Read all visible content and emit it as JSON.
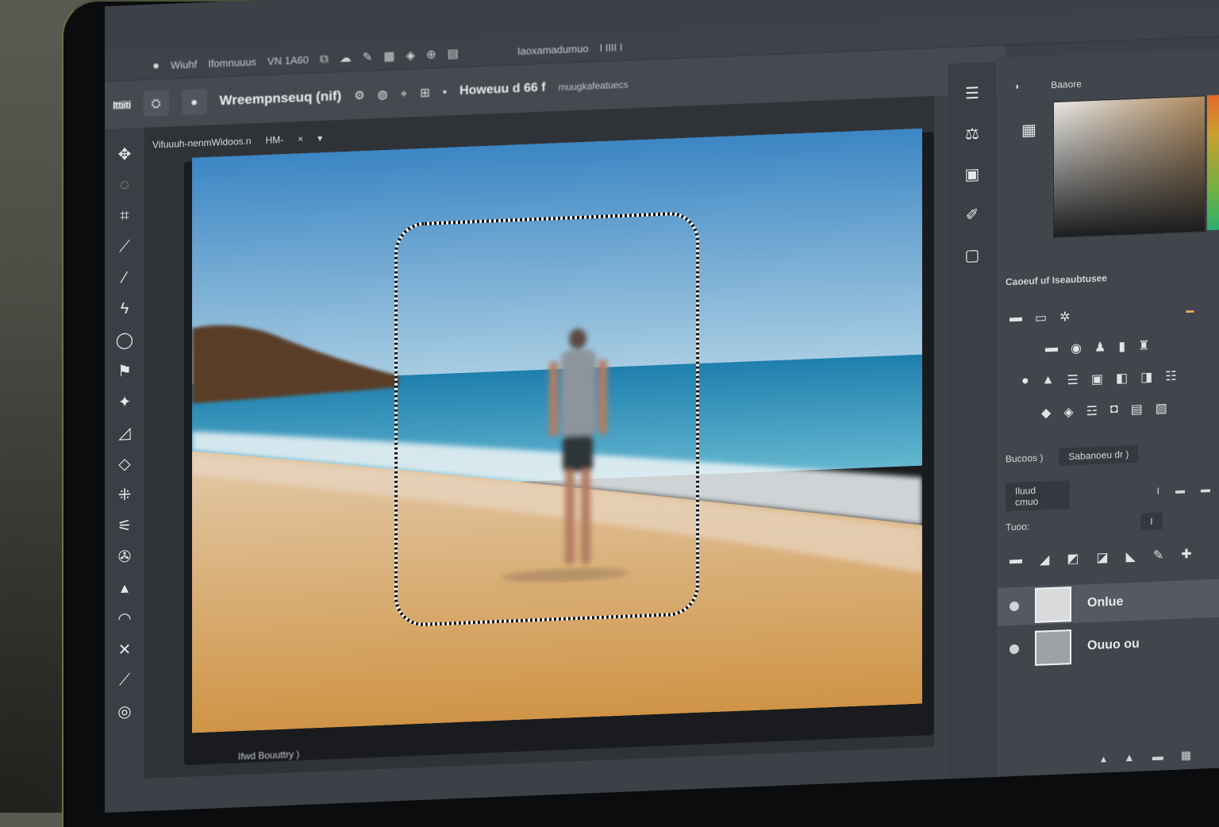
{
  "menubar": {
    "items": [
      "Wiuhf",
      "Ifomnuuus",
      "VN 1A60"
    ],
    "icons": [
      "bell-icon",
      "layers-icon",
      "cloud-icon",
      "pen-icon",
      "grid-icon",
      "shapes-icon",
      "zoom-icon",
      "window-icon"
    ],
    "right": [
      "Iaoxamadumuo",
      "I IIII I"
    ]
  },
  "options": {
    "app_badge": "Ittiiti",
    "doc_title": "Wreempnseuq (nif)",
    "zoom": "Howeuu d 66 f",
    "hint": "muugkafeatuecs"
  },
  "doc_tab": {
    "label": "Vifuuuh-nenmWidoos.n",
    "mode": "HM-",
    "close": "×"
  },
  "status": "Ifwd Bouuttry )",
  "panels": {
    "color_label": "Baaore",
    "properties_title": "Caoeuf uf Iseaubtusee",
    "prop_rows": [
      {
        "label": "Bucoos )",
        "value": "Sabanoeu dr )"
      },
      {
        "label": "Iluud cmuo",
        "value": "I"
      },
      {
        "label": "Tuoo:",
        "value": "I"
      }
    ],
    "layers": [
      {
        "name": "Onlue",
        "active": true
      },
      {
        "name": "Ouuo ou",
        "active": false
      }
    ]
  },
  "colors": {
    "accent": "#f0a85a",
    "sky": "#4f93c8",
    "sea": "#2a8fb5",
    "sand": "#d8a256"
  }
}
